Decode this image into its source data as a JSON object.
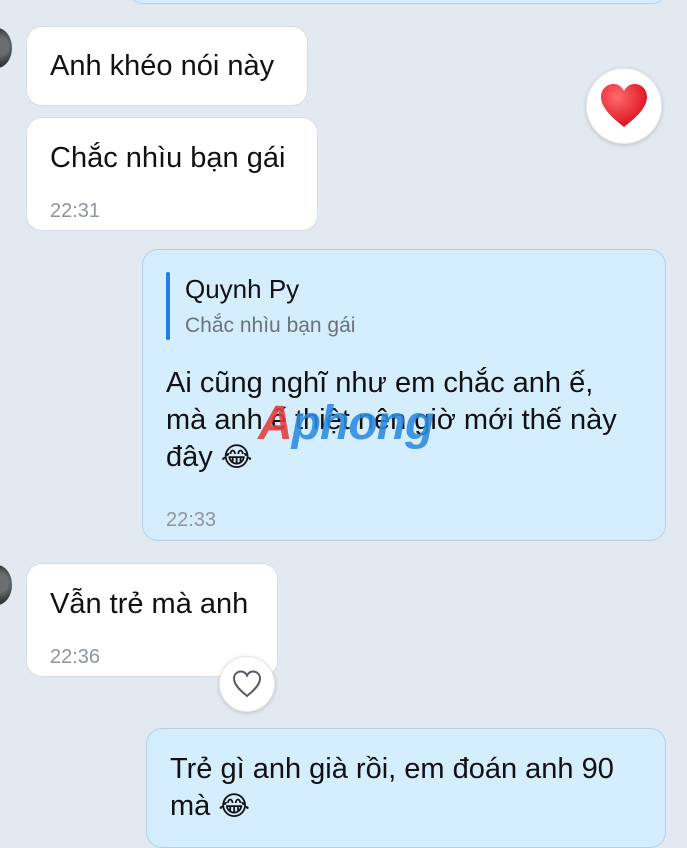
{
  "messages": [
    {
      "text": "Anh khéo nói này"
    },
    {
      "text": "Chắc nhìu bạn gái",
      "time": "22:31"
    },
    {
      "reply": {
        "author": "Quynh Py",
        "quote": "Chắc nhìu bạn gái"
      },
      "line1": "Ai cũng nghĩ như em chắc anh ế,",
      "line2": "mà anh ế thiệt nên giờ mới thế này",
      "line3": "đây",
      "emoji": "😂",
      "time": "22:33"
    },
    {
      "text": "Vẫn trẻ mà anh",
      "time": "22:36"
    },
    {
      "line1": "Trẻ gì anh già rồi, em đoán anh 90",
      "line2": "mà",
      "emoji": "😂"
    }
  ],
  "reactions": {
    "heart": "❤️",
    "heart_outline": "♡"
  },
  "watermark": {
    "part1": "A",
    "part2": "phong"
  }
}
